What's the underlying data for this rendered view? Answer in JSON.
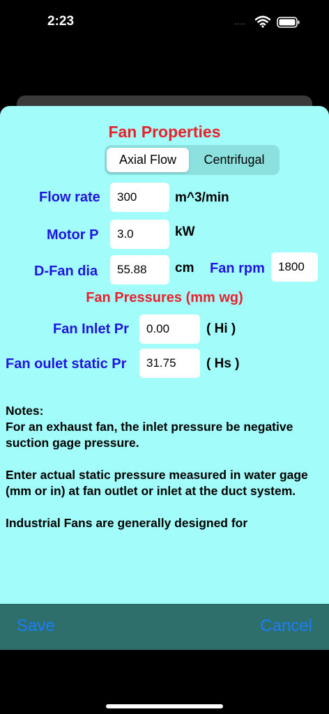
{
  "status": {
    "time": "2:23",
    "dots": "...."
  },
  "title": "Fan Properties",
  "segments": {
    "axial": "Axial Flow",
    "centrifugal": "Centrifugal"
  },
  "fields": {
    "flow_rate": {
      "label": "Flow rate",
      "value": "300",
      "unit": "m^3/min"
    },
    "motor_p": {
      "label": "Motor P",
      "value": "3.0",
      "unit": "kW"
    },
    "fan_dia": {
      "label": "D-Fan dia",
      "value": "55.88",
      "unit": "cm"
    },
    "fan_rpm": {
      "label": "Fan rpm",
      "value": "1800"
    }
  },
  "pressures": {
    "heading": "Fan Pressures (mm wg)",
    "inlet": {
      "label": "Fan Inlet Pr",
      "value": "0.00",
      "unit": "( Hi )"
    },
    "outlet": {
      "label": "Fan oulet static Pr",
      "value": "31.75",
      "unit": "( Hs )"
    }
  },
  "notes": {
    "heading": "Notes:",
    "p1": "For an exhaust fan, the inlet pressure be negative suction gage pressure.",
    "p2": "Enter actual static pressure measured in water gage (mm or in) at fan outlet or inlet at the duct system.",
    "p3": "Industrial Fans are generally designed for"
  },
  "actions": {
    "save": "Save",
    "cancel": "Cancel"
  },
  "colors": {
    "sheet": "#a2fcf9",
    "title_red": "#e8222d",
    "label_blue": "#1f14e0",
    "bar": "#2f6f6b",
    "button_blue": "#1a7cff"
  }
}
